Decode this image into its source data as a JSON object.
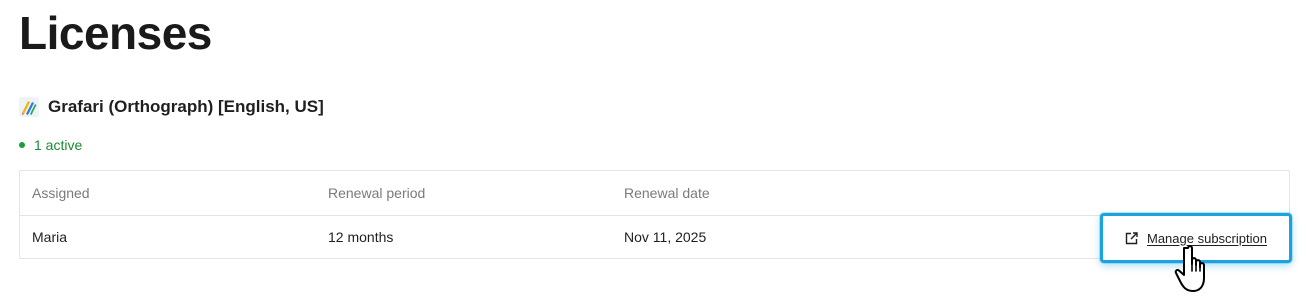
{
  "page": {
    "title": "Licenses"
  },
  "product": {
    "icon": "pencils-logo-icon",
    "name": "Grafari (Orthograph) [English, US]"
  },
  "status": {
    "text": "1 active",
    "color": "#1a9e3a"
  },
  "table": {
    "columns": [
      "Assigned",
      "Renewal period",
      "Renewal date"
    ],
    "rows": [
      {
        "assigned": "Maria",
        "renewal_period": "12 months",
        "renewal_date": "Nov 11, 2025"
      }
    ]
  },
  "actions": {
    "manage_subscription": "Manage subscription",
    "icon": "external-link-icon",
    "highlight_color": "#1ba3e0"
  },
  "cursor": {
    "icon": "hand-pointer-icon"
  }
}
